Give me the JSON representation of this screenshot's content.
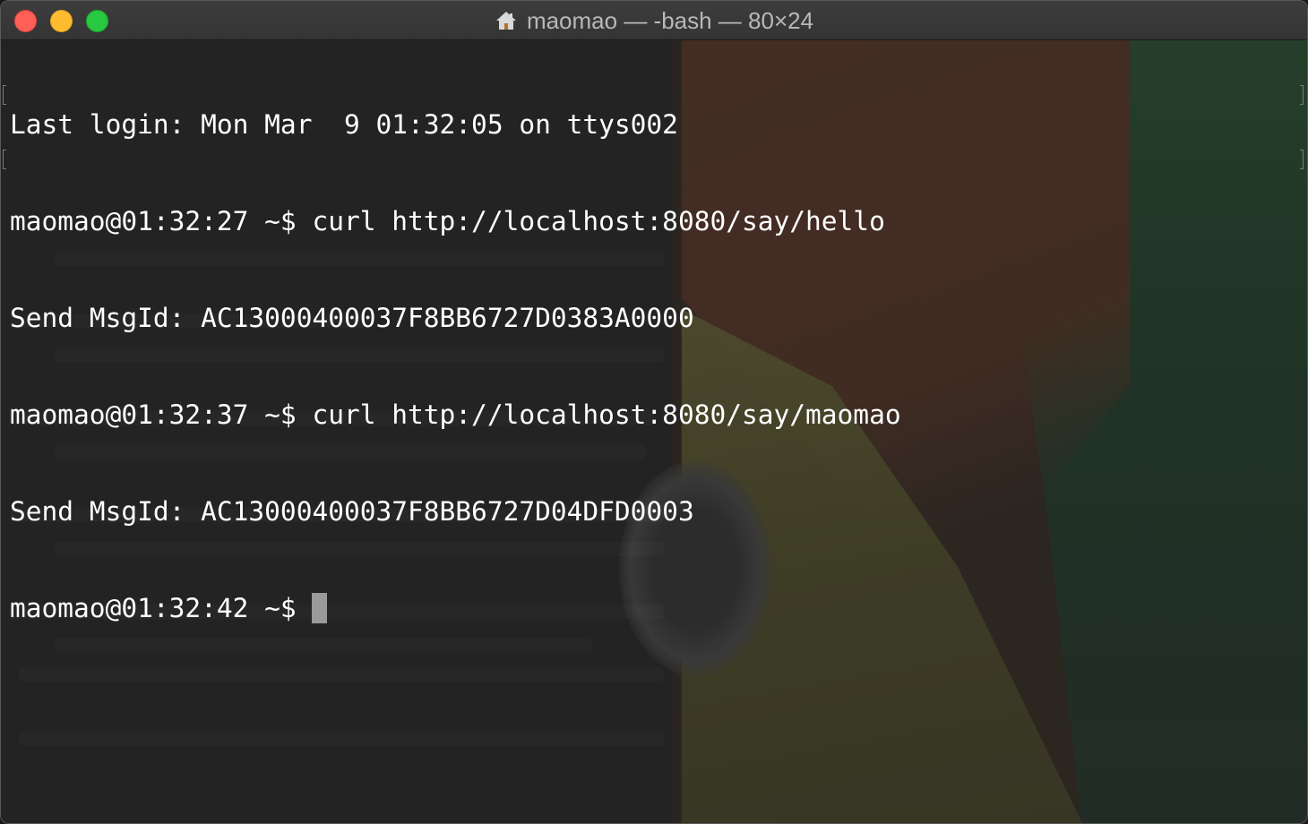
{
  "window": {
    "title": "maomao — -bash — 80×24",
    "home_icon": "home-icon"
  },
  "traffic_lights": {
    "close_color": "#fe5f57",
    "minimize_color": "#febc2e",
    "zoom_color": "#28c840"
  },
  "terminal": {
    "lines": [
      "Last login: Mon Mar  9 01:32:05 on ttys002",
      "maomao@01:32:27 ~$ curl http://localhost:8080/say/hello",
      "Send MsgId: AC13000400037F8BB6727D0383A0000",
      "maomao@01:32:37 ~$ curl http://localhost:8080/say/maomao",
      "Send MsgId: AC13000400037F8BB6727D04DFD0003"
    ],
    "prompt": "maomao@01:32:42 ~$ ",
    "cursor": "block"
  }
}
